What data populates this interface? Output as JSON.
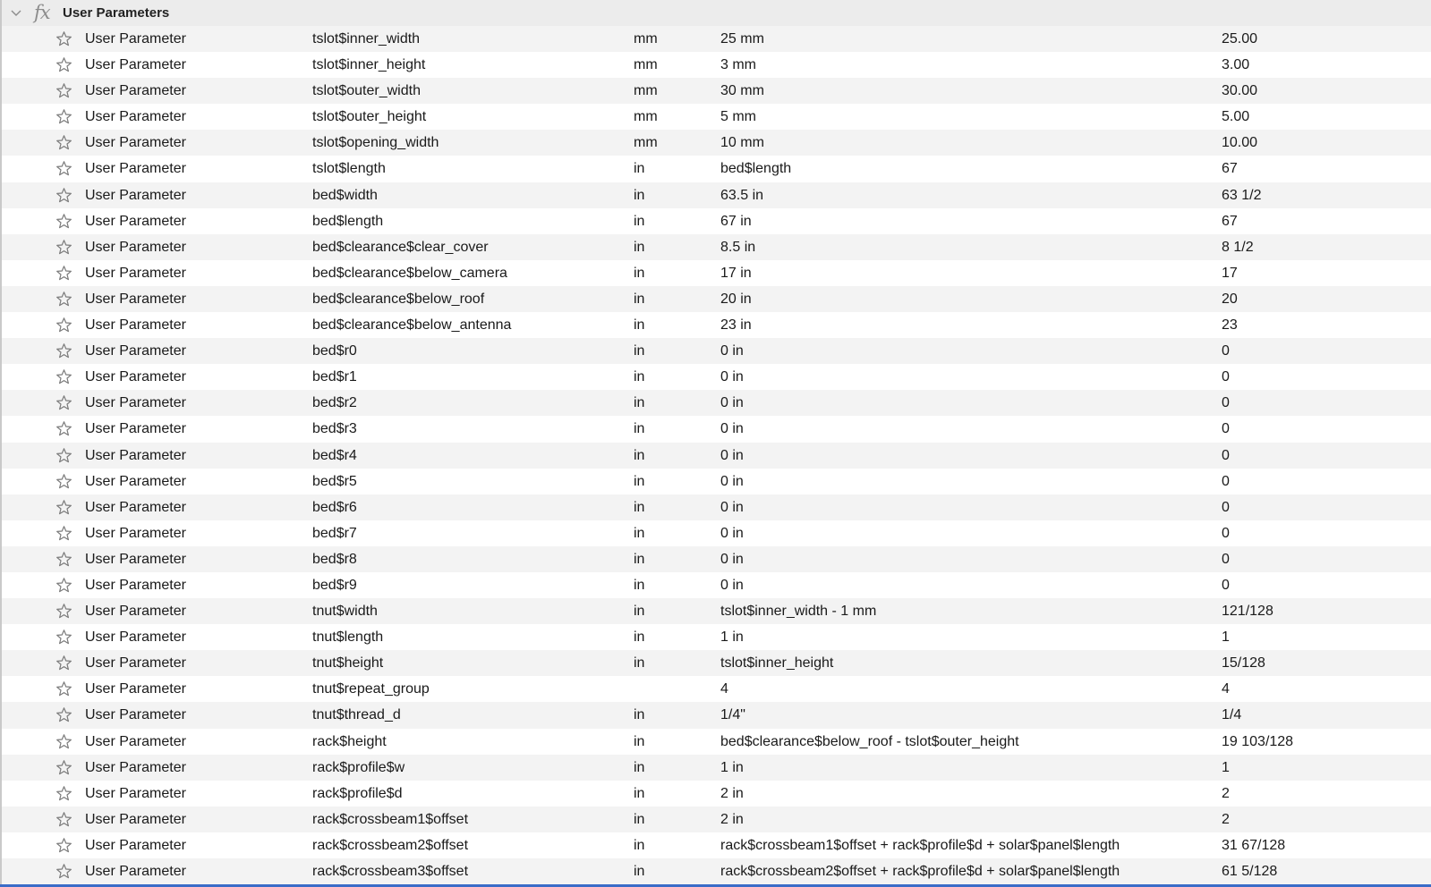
{
  "group": {
    "title": "User Parameters",
    "icon_text": "fx",
    "icon": "fx-icon",
    "expand_icon": "chevron-down-icon"
  },
  "colors": {
    "header_bg": "#ececec",
    "row_alt_bg": "#f3f3f3",
    "accent": "#3a6cc8",
    "icon": "#8c8c8c"
  },
  "row_icon": "star-icon",
  "rows": [
    {
      "type": "User Parameter",
      "name": "tslot$inner_width",
      "unit": "mm",
      "expression": "25 mm",
      "value": "25.00"
    },
    {
      "type": "User Parameter",
      "name": "tslot$inner_height",
      "unit": "mm",
      "expression": "3 mm",
      "value": "3.00"
    },
    {
      "type": "User Parameter",
      "name": "tslot$outer_width",
      "unit": "mm",
      "expression": "30 mm",
      "value": "30.00"
    },
    {
      "type": "User Parameter",
      "name": "tslot$outer_height",
      "unit": "mm",
      "expression": "5 mm",
      "value": "5.00"
    },
    {
      "type": "User Parameter",
      "name": "tslot$opening_width",
      "unit": "mm",
      "expression": "10 mm",
      "value": "10.00"
    },
    {
      "type": "User Parameter",
      "name": "tslot$length",
      "unit": "in",
      "expression": "bed$length",
      "value": "67"
    },
    {
      "type": "User Parameter",
      "name": "bed$width",
      "unit": "in",
      "expression": "63.5 in",
      "value": "63 1/2"
    },
    {
      "type": "User Parameter",
      "name": "bed$length",
      "unit": "in",
      "expression": "67 in",
      "value": "67"
    },
    {
      "type": "User Parameter",
      "name": "bed$clearance$clear_cover",
      "unit": "in",
      "expression": "8.5 in",
      "value": "8 1/2"
    },
    {
      "type": "User Parameter",
      "name": "bed$clearance$below_camera",
      "unit": "in",
      "expression": "17 in",
      "value": "17"
    },
    {
      "type": "User Parameter",
      "name": "bed$clearance$below_roof",
      "unit": "in",
      "expression": "20 in",
      "value": "20"
    },
    {
      "type": "User Parameter",
      "name": "bed$clearance$below_antenna",
      "unit": "in",
      "expression": "23 in",
      "value": "23"
    },
    {
      "type": "User Parameter",
      "name": "bed$r0",
      "unit": "in",
      "expression": "0 in",
      "value": "0"
    },
    {
      "type": "User Parameter",
      "name": "bed$r1",
      "unit": "in",
      "expression": "0 in",
      "value": "0"
    },
    {
      "type": "User Parameter",
      "name": "bed$r2",
      "unit": "in",
      "expression": "0 in",
      "value": "0"
    },
    {
      "type": "User Parameter",
      "name": "bed$r3",
      "unit": "in",
      "expression": "0 in",
      "value": "0"
    },
    {
      "type": "User Parameter",
      "name": "bed$r4",
      "unit": "in",
      "expression": "0 in",
      "value": "0"
    },
    {
      "type": "User Parameter",
      "name": "bed$r5",
      "unit": "in",
      "expression": "0 in",
      "value": "0"
    },
    {
      "type": "User Parameter",
      "name": "bed$r6",
      "unit": "in",
      "expression": "0 in",
      "value": "0"
    },
    {
      "type": "User Parameter",
      "name": "bed$r7",
      "unit": "in",
      "expression": "0 in",
      "value": "0"
    },
    {
      "type": "User Parameter",
      "name": "bed$r8",
      "unit": "in",
      "expression": "0 in",
      "value": "0"
    },
    {
      "type": "User Parameter",
      "name": "bed$r9",
      "unit": "in",
      "expression": "0 in",
      "value": "0"
    },
    {
      "type": "User Parameter",
      "name": "tnut$width",
      "unit": "in",
      "expression": "tslot$inner_width - 1 mm",
      "value": "121/128"
    },
    {
      "type": "User Parameter",
      "name": "tnut$length",
      "unit": "in",
      "expression": "1 in",
      "value": "1"
    },
    {
      "type": "User Parameter",
      "name": "tnut$height",
      "unit": "in",
      "expression": "tslot$inner_height",
      "value": "15/128"
    },
    {
      "type": "User Parameter",
      "name": "tnut$repeat_group",
      "unit": "",
      "expression": "4",
      "value": "4"
    },
    {
      "type": "User Parameter",
      "name": "tnut$thread_d",
      "unit": "in",
      "expression": "1/4\"",
      "value": "1/4"
    },
    {
      "type": "User Parameter",
      "name": "rack$height",
      "unit": "in",
      "expression": "bed$clearance$below_roof - tslot$outer_height",
      "value": "19 103/128"
    },
    {
      "type": "User Parameter",
      "name": "rack$profile$w",
      "unit": "in",
      "expression": "1 in",
      "value": "1"
    },
    {
      "type": "User Parameter",
      "name": "rack$profile$d",
      "unit": "in",
      "expression": "2 in",
      "value": "2"
    },
    {
      "type": "User Parameter",
      "name": "rack$crossbeam1$offset",
      "unit": "in",
      "expression": "2 in",
      "value": "2"
    },
    {
      "type": "User Parameter",
      "name": "rack$crossbeam2$offset",
      "unit": "in",
      "expression": "rack$crossbeam1$offset + rack$profile$d + solar$panel$length",
      "value": "31 67/128"
    },
    {
      "type": "User Parameter",
      "name": "rack$crossbeam3$offset",
      "unit": "in",
      "expression": "rack$crossbeam2$offset + rack$profile$d + solar$panel$length",
      "value": "61 5/128"
    }
  ]
}
